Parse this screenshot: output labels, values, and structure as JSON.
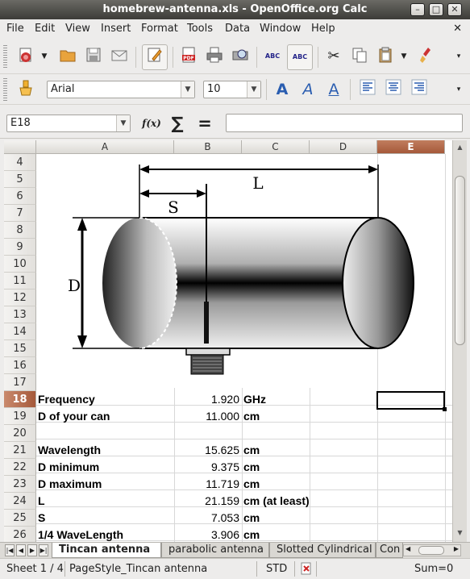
{
  "window": {
    "title": "homebrew-antenna.xls - OpenOffice.org Calc",
    "minimize": "–",
    "maximize": "□",
    "close": "✕"
  },
  "menu": {
    "items": [
      "File",
      "Edit",
      "View",
      "Insert",
      "Format",
      "Tools",
      "Data",
      "Window",
      "Help"
    ],
    "close_doc": "✕"
  },
  "toolbar": {
    "font_name": "Arial",
    "font_size": "10",
    "spell1": "ABC",
    "spell2": "ABC",
    "font_a": "A",
    "pdf": "PDF"
  },
  "formula": {
    "cell_ref": "E18",
    "fx": "f(x)",
    "sum": "∑",
    "equals": "=",
    "content": ""
  },
  "columns": [
    "A",
    "B",
    "C",
    "D",
    "E"
  ],
  "selected_column": "E",
  "selected_row": "18",
  "rows": [
    "4",
    "5",
    "6",
    "7",
    "8",
    "9",
    "10",
    "11",
    "12",
    "13",
    "14",
    "15",
    "16",
    "17",
    "18",
    "19",
    "20",
    "21",
    "22",
    "23",
    "24",
    "25",
    "26"
  ],
  "diagram": {
    "label_L": "L",
    "label_S": "S",
    "label_D": "D"
  },
  "table": [
    {
      "row": "18",
      "label": "Frequency",
      "value": "1.920",
      "unit": "GHz"
    },
    {
      "row": "19",
      "label": "D of your can",
      "value": "11.000",
      "unit": "cm"
    },
    {
      "row": "21",
      "label": "Wavelength",
      "value": "15.625",
      "unit": "cm"
    },
    {
      "row": "22",
      "label": "D minimum",
      "value": "9.375",
      "unit": "cm"
    },
    {
      "row": "23",
      "label": "D maximum",
      "value": "11.719",
      "unit": "cm"
    },
    {
      "row": "24",
      "label": "L",
      "value": "21.159",
      "unit": "cm (at least)"
    },
    {
      "row": "25",
      "label": "S",
      "value": "7.053",
      "unit": "cm"
    },
    {
      "row": "26",
      "label": "1/4 WaveLength",
      "value": "3.906",
      "unit": "cm"
    }
  ],
  "sheet_tabs": [
    "Tincan antenna",
    "parabolic antenna",
    "Slotted Cylindrical",
    "Con"
  ],
  "active_sheet": "Tincan antenna",
  "status": {
    "sheet": "Sheet 1 / 4",
    "page_style": "PageStyle_Tincan antenna",
    "mode": "STD",
    "sum": "Sum=0"
  }
}
